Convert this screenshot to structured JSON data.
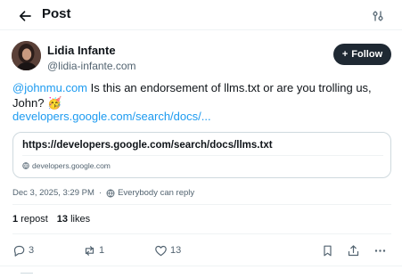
{
  "header": {
    "title": "Post",
    "back_icon": "arrow-left-icon",
    "settings_icon": "sliders-icon"
  },
  "author": {
    "name": "Lidia Infante",
    "handle": "@lidia-infante.com"
  },
  "follow": {
    "label": "Follow",
    "icon": "plus-icon"
  },
  "post": {
    "mention": "@johnmu.com",
    "text": " Is this an endorsement of llms.txt or are you trolling us, John? 🥳",
    "link": "developers.google.com/search/docs/..."
  },
  "card": {
    "title": "https://developers.google.com/search/docs/llms.txt",
    "domain": "developers.google.com"
  },
  "meta": {
    "timestamp": "Dec 3, 2025, 3:29 PM",
    "separator": "·",
    "audience": "Everybody can reply"
  },
  "stats": {
    "reposts_count": "1",
    "reposts_label": "repost",
    "likes_count": "13",
    "likes_label": "likes"
  },
  "actions": {
    "replies": "3",
    "reposts": "1",
    "likes": "13"
  },
  "colors": {
    "accent": "#1d9bf0",
    "follow_bg": "#1f2933",
    "muted": "#536471"
  }
}
